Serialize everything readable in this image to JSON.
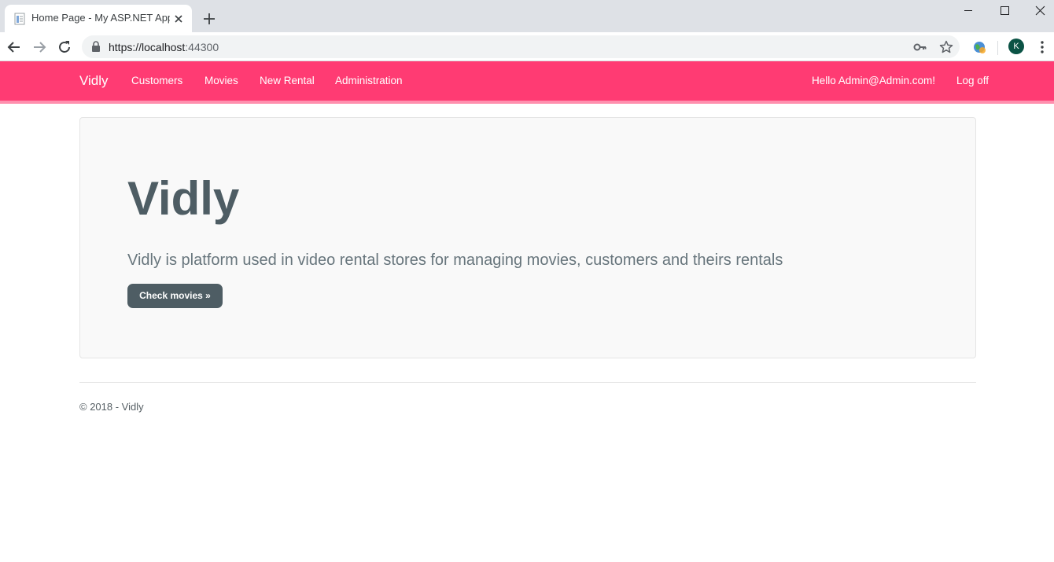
{
  "browser": {
    "tab_title": "Home Page - My ASP.NET Applic",
    "url_main": "https://localhost",
    "url_port": ":44300",
    "profile_initial": "K",
    "icons": [
      "page-favicon-icon",
      "close-icon",
      "plus-icon",
      "minimize-icon",
      "maximize-icon",
      "close-window-icon",
      "back-arrow-icon",
      "forward-arrow-icon",
      "reload-icon",
      "lock-icon",
      "key-icon",
      "star-icon",
      "extension-icon",
      "kebab-menu-icon"
    ]
  },
  "navbar": {
    "brand": "Vidly",
    "links": [
      "Customers",
      "Movies",
      "New Rental",
      "Administration"
    ],
    "greeting": "Hello Admin@Admin.com!",
    "logoff": "Log off",
    "color": "#ff3b73"
  },
  "jumbotron": {
    "title": "Vidly",
    "lead": "Vidly is platform used in video rental stores for managing movies, customers and theirs rentals",
    "button": "Check movies »"
  },
  "footer": {
    "text": "© 2018 - Vidly"
  }
}
